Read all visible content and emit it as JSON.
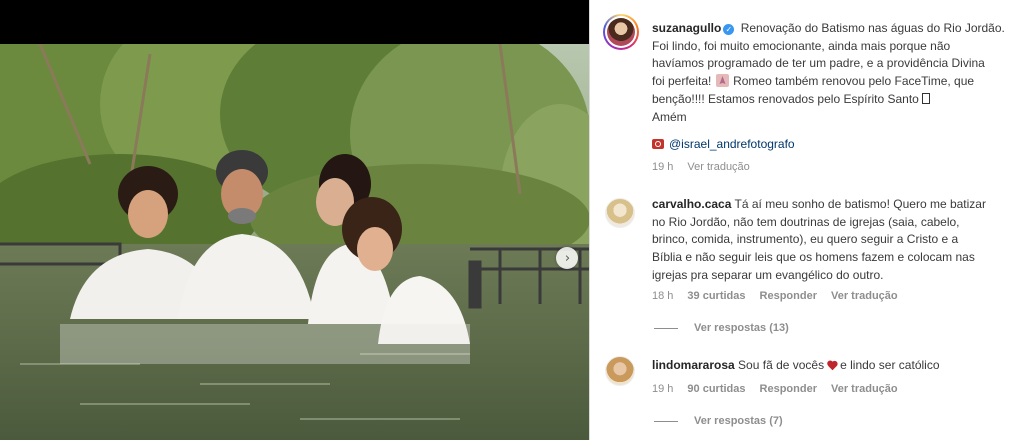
{
  "post": {
    "author": "suzanagullo",
    "caption_line1": "Renovação do Batismo nas águas do Rio Jordão.",
    "caption_line2": "Foi lindo, foi muito emocionante, ainda mais porque não",
    "caption_line3": "havíamos programado de ter um padre, e a providência Divina",
    "caption_line4a": "foi perfeita!",
    "caption_line4b": "Romeo também renovou pelo FaceTime, que",
    "caption_line5": "benção!!!! Estamos renovados pelo Espírito Santo",
    "caption_line6": "Amém",
    "photo_credit": "@israel_andrefotografo",
    "time": "19 h",
    "translate_label": "Ver tradução",
    "icons": {
      "verified": "verified-badge-icon",
      "pray_emoji": "praying-hands-emoji",
      "camera": "camera-icon",
      "next": "chevron-right-icon"
    }
  },
  "comments": [
    {
      "username": "carvalho.caca",
      "text_line1": "Tá aí meu sonho de batismo! Quero me batizar",
      "text_line2": "no Rio Jordão, não tem doutrinas de igrejas (saia, cabelo,",
      "text_line3": "brinco, comida, instrumento), eu quero seguir a Cristo e a",
      "text_line4": "Bíblia e não seguir leis que os homens fazem e colocam nas",
      "text_line5": "igrejas pra separar um evangélico do outro.",
      "time": "18 h",
      "likes": "39 curtidas",
      "reply_label": "Responder",
      "translate_label": "Ver tradução",
      "view_replies": "Ver respostas (13)"
    },
    {
      "username": "lindomararosa",
      "text_before": "Sou fã de vocês",
      "text_after": "e lindo ser católico",
      "time": "19 h",
      "likes": "90 curtidas",
      "reply_label": "Responder",
      "translate_label": "Ver tradução",
      "view_replies": "Ver respostas (7)"
    }
  ],
  "colors": {
    "link": "#00376b",
    "muted": "#8e8e8e",
    "verified": "#3897f0",
    "heart": "#c0272d"
  }
}
